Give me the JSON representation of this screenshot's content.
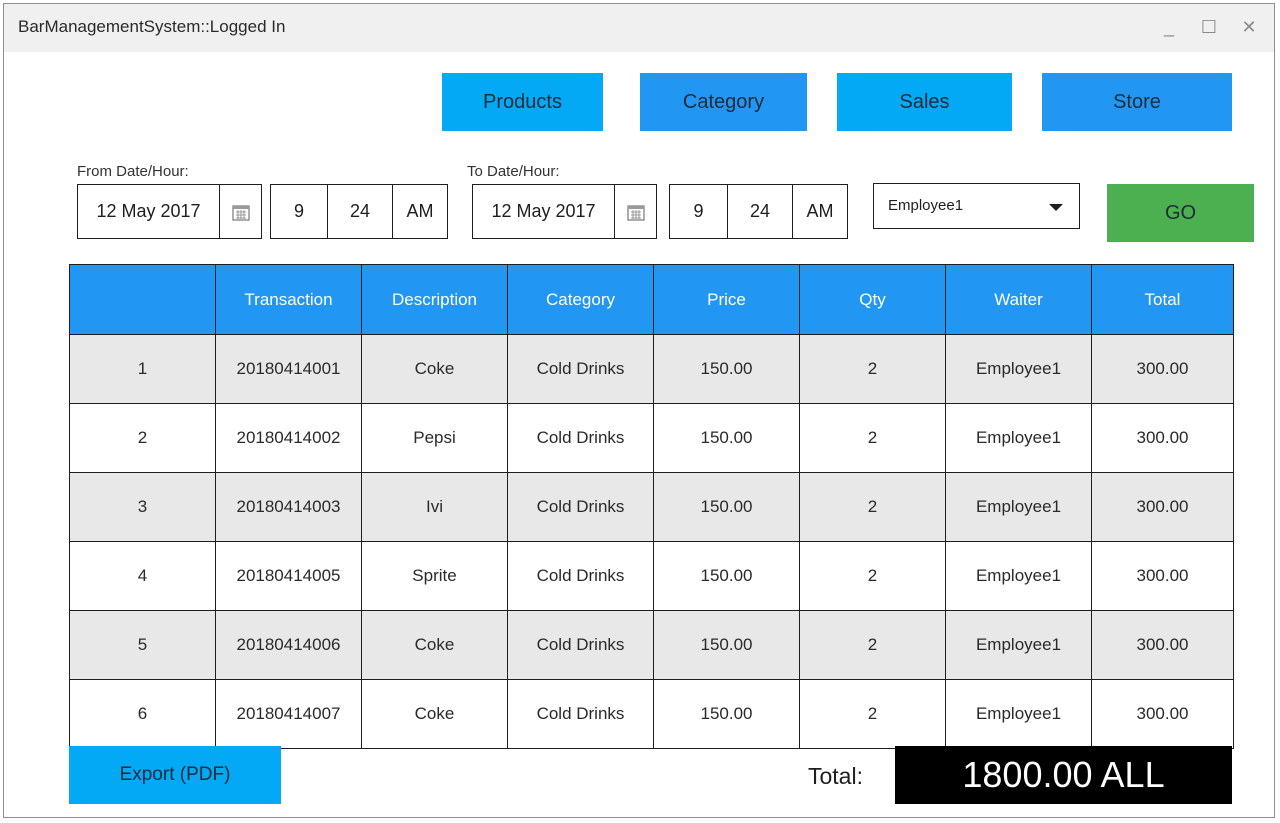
{
  "window": {
    "title": "BarManagementSystem::Logged In",
    "controls": {
      "minimize": "_",
      "maximize": "☐",
      "close": "✕"
    }
  },
  "nav": {
    "products": "Products",
    "category": "Category",
    "sales": "Sales",
    "store": "Store"
  },
  "filters": {
    "from_label": "From Date/Hour:",
    "from_date": "12 May 2017",
    "from_hour": "9",
    "from_minute": "24",
    "from_ampm": "AM",
    "to_label": "To Date/Hour:",
    "to_date": "12 May 2017",
    "to_hour": "9",
    "to_minute": "24",
    "to_ampm": "AM",
    "employee": "Employee1",
    "go_label": "GO"
  },
  "table": {
    "headers": [
      "",
      "Transaction",
      "Description",
      "Category",
      "Price",
      "Qty",
      "Waiter",
      "Total"
    ],
    "rows": [
      [
        "1",
        "20180414001",
        "Coke",
        "Cold Drinks",
        "150.00",
        "2",
        "Employee1",
        "300.00"
      ],
      [
        "2",
        "20180414002",
        "Pepsi",
        "Cold Drinks",
        "150.00",
        "2",
        "Employee1",
        "300.00"
      ],
      [
        "3",
        "20180414003",
        "Ivi",
        "Cold Drinks",
        "150.00",
        "2",
        "Employee1",
        "300.00"
      ],
      [
        "4",
        "20180414005",
        "Sprite",
        "Cold Drinks",
        "150.00",
        "2",
        "Employee1",
        "300.00"
      ],
      [
        "5",
        "20180414006",
        "Coke",
        "Cold Drinks",
        "150.00",
        "2",
        "Employee1",
        "300.00"
      ],
      [
        "6",
        "20180414007",
        "Coke",
        "Cold Drinks",
        "150.00",
        "2",
        "Employee1",
        "300.00"
      ]
    ]
  },
  "footer": {
    "export_label": "Export (PDF)",
    "total_label": "Total:",
    "total_value": "1800.00 ALL"
  },
  "colors": {
    "nav_light_blue": "#03a9f4",
    "nav_blue": "#2196f3",
    "header_blue": "#2196f3",
    "go_green": "#4caf50",
    "row_alt_gray": "#e8e8e8",
    "total_bg": "#000000"
  },
  "icons": {
    "calendar": "calendar-icon",
    "dropdown": "chevron-down-icon"
  }
}
